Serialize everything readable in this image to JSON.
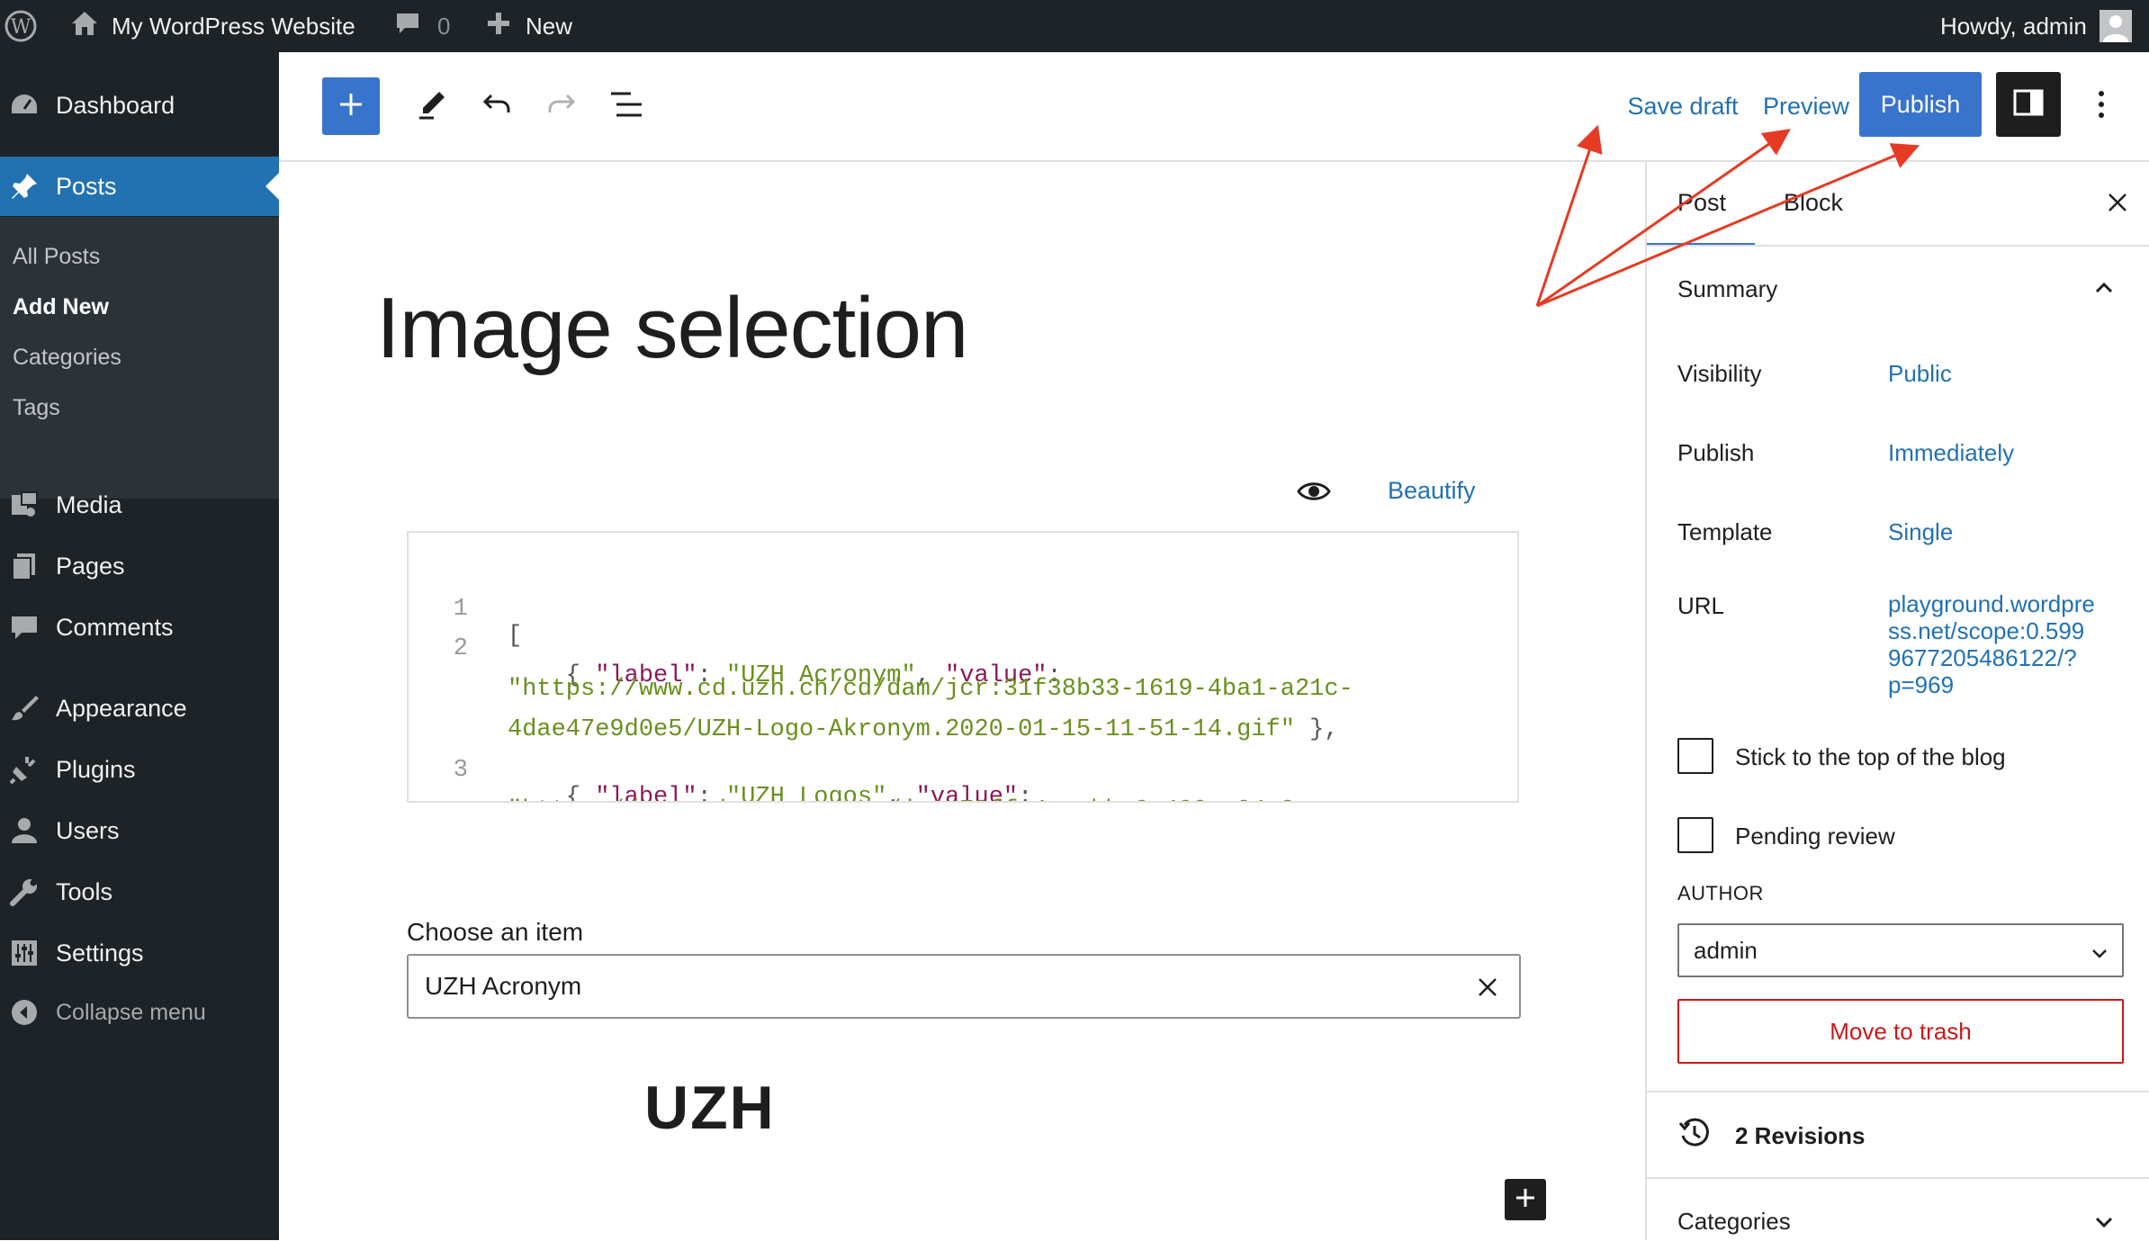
{
  "adminbar": {
    "site_name": "My WordPress Website",
    "comments_count": "0",
    "new_label": "New",
    "howdy": "Howdy, admin"
  },
  "sidebar": {
    "items": [
      {
        "label": "Dashboard",
        "icon": "dashboard-icon"
      },
      {
        "label": "Posts",
        "icon": "pin-icon"
      },
      {
        "label": "Media",
        "icon": "media-icon"
      },
      {
        "label": "Pages",
        "icon": "pages-icon"
      },
      {
        "label": "Comments",
        "icon": "comments-icon"
      },
      {
        "label": "Appearance",
        "icon": "appearance-icon"
      },
      {
        "label": "Plugins",
        "icon": "plugins-icon"
      },
      {
        "label": "Users",
        "icon": "users-icon"
      },
      {
        "label": "Tools",
        "icon": "tools-icon"
      },
      {
        "label": "Settings",
        "icon": "settings-icon"
      }
    ],
    "submenu": [
      "All Posts",
      "Add New",
      "Categories",
      "Tags"
    ],
    "collapse_label": "Collapse menu"
  },
  "toolbar": {
    "save_draft": "Save draft",
    "preview": "Preview",
    "publish": "Publish"
  },
  "editor": {
    "title": "Image selection",
    "beautify": "Beautify",
    "code": {
      "line_numbers": [
        "1",
        "2",
        "3"
      ]
    },
    "choose_label": "Choose an item",
    "choose_value": "UZH Acronym",
    "logo_text": "UZH"
  },
  "panel": {
    "tabs": [
      "Post",
      "Block"
    ],
    "summary_title": "Summary",
    "rows": [
      {
        "label": "Visibility",
        "value": "Public"
      },
      {
        "label": "Publish",
        "value": "Immediately"
      },
      {
        "label": "Template",
        "value": "Single"
      },
      {
        "label": "URL",
        "value_lines": [
          "playground.wordpre",
          "ss.net/scope:0.599",
          "9677205486122/?",
          "p=969"
        ]
      }
    ],
    "sticky_label": "Stick to the top of the blog",
    "pending_label": "Pending review",
    "author_heading": "AUTHOR",
    "author_value": "admin",
    "trash_label": "Move to trash",
    "revisions_label": "2 Revisions",
    "categories_label": "Categories"
  },
  "colors": {
    "admin_dark": "#1d2327",
    "accent_blue": "#3874cb",
    "link_blue": "#2271b1",
    "annotation_red": "#e53b24",
    "trash_red": "#cc1818"
  }
}
